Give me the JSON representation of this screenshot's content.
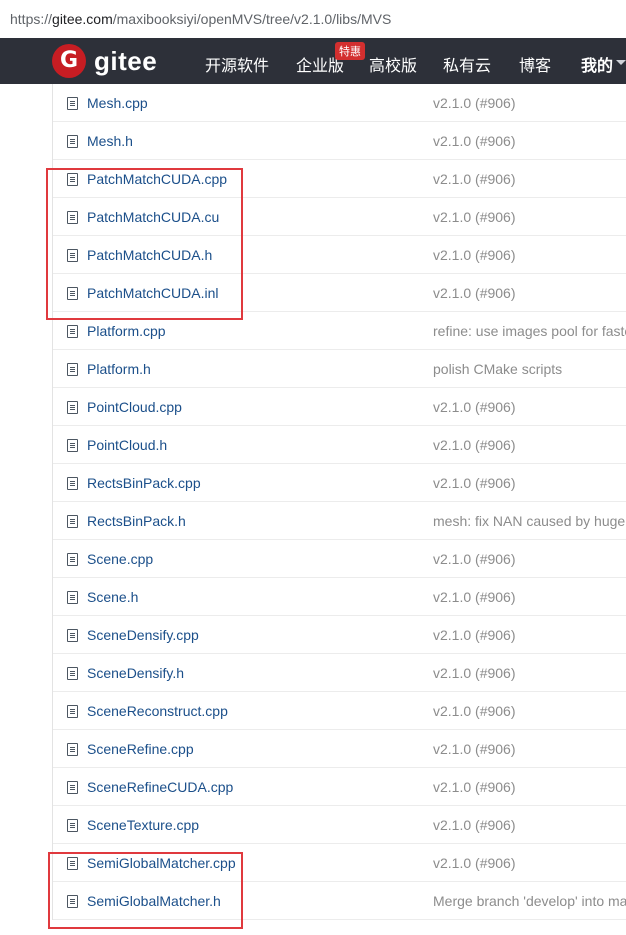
{
  "browser": {
    "url_prefix": "https://",
    "url_host": "gitee.com",
    "url_path": "/maxibooksiyi/openMVS/tree/v2.1.0/libs/MVS"
  },
  "header": {
    "logo_glyph": "G",
    "logo_text": "gitee",
    "nav": {
      "open_source": "开源软件",
      "enterprise": "企业版",
      "enterprise_badge": "特惠",
      "education": "高校版",
      "private_cloud": "私有云",
      "blog": "博客",
      "mine": "我的"
    },
    "brand_color": "#c71d23",
    "bar_color": "#2d3039"
  },
  "files": [
    {
      "name": "Mesh.cpp",
      "commit": "v2.1.0 (#906)"
    },
    {
      "name": "Mesh.h",
      "commit": "v2.1.0 (#906)"
    },
    {
      "name": "PatchMatchCUDA.cpp",
      "commit": "v2.1.0 (#906)"
    },
    {
      "name": "PatchMatchCUDA.cu",
      "commit": "v2.1.0 (#906)"
    },
    {
      "name": "PatchMatchCUDA.h",
      "commit": "v2.1.0 (#906)"
    },
    {
      "name": "PatchMatchCUDA.inl",
      "commit": "v2.1.0 (#906)"
    },
    {
      "name": "Platform.cpp",
      "commit": "refine: use images pool for faste"
    },
    {
      "name": "Platform.h",
      "commit": "polish CMake scripts"
    },
    {
      "name": "PointCloud.cpp",
      "commit": "v2.1.0 (#906)"
    },
    {
      "name": "PointCloud.h",
      "commit": "v2.1.0 (#906)"
    },
    {
      "name": "RectsBinPack.cpp",
      "commit": "v2.1.0 (#906)"
    },
    {
      "name": "RectsBinPack.h",
      "commit": "mesh: fix NAN caused by huge s"
    },
    {
      "name": "Scene.cpp",
      "commit": "v2.1.0 (#906)"
    },
    {
      "name": "Scene.h",
      "commit": "v2.1.0 (#906)"
    },
    {
      "name": "SceneDensify.cpp",
      "commit": "v2.1.0 (#906)"
    },
    {
      "name": "SceneDensify.h",
      "commit": "v2.1.0 (#906)"
    },
    {
      "name": "SceneReconstruct.cpp",
      "commit": "v2.1.0 (#906)"
    },
    {
      "name": "SceneRefine.cpp",
      "commit": "v2.1.0 (#906)"
    },
    {
      "name": "SceneRefineCUDA.cpp",
      "commit": "v2.1.0 (#906)"
    },
    {
      "name": "SceneTexture.cpp",
      "commit": "v2.1.0 (#906)"
    },
    {
      "name": "SemiGlobalMatcher.cpp",
      "commit": "v2.1.0 (#906)"
    },
    {
      "name": "SemiGlobalMatcher.h",
      "commit": "Merge branch 'develop' into ma"
    }
  ],
  "highlight_color": "#e0393e"
}
